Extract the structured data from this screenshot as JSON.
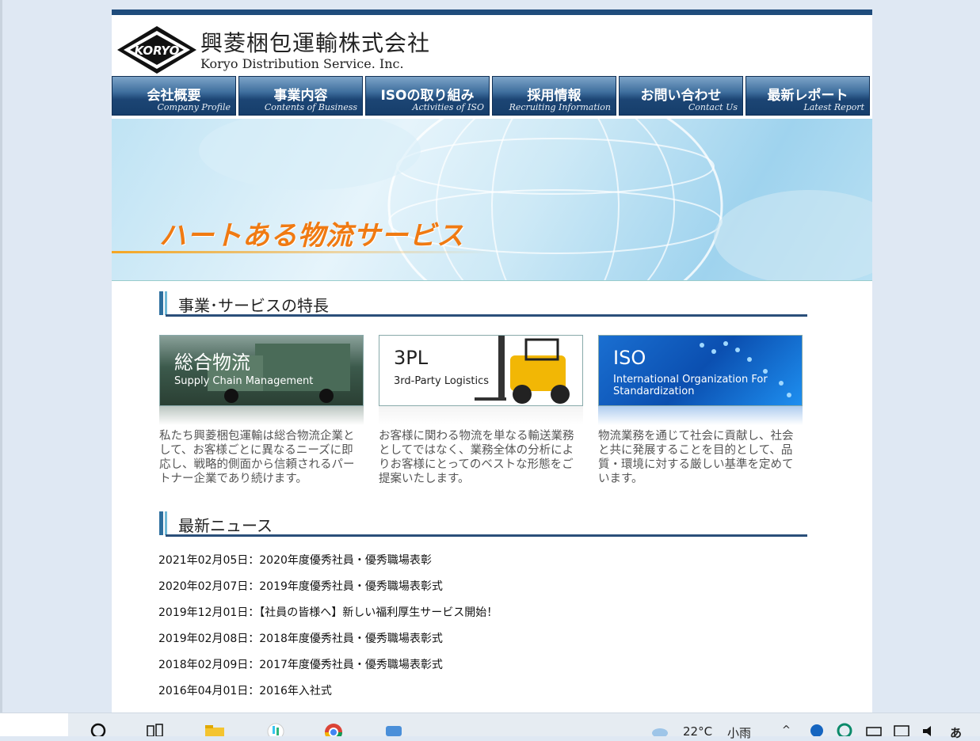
{
  "header": {
    "company_jp": "興菱梱包運輸株式会社",
    "company_en": "Koryo Distribution Service. Inc."
  },
  "nav": [
    {
      "jp": "会社概要",
      "en": "Company Profile"
    },
    {
      "jp": "事業内容",
      "en": "Contents of Business"
    },
    {
      "jp": "ISOの取り組み",
      "en": "Activities of ISO"
    },
    {
      "jp": "採用情報",
      "en": "Recruiting Information"
    },
    {
      "jp": "お問い合わせ",
      "en": "Contact Us"
    },
    {
      "jp": "最新レポート",
      "en": "Latest Report"
    }
  ],
  "hero": {
    "title": "ハートある物流サービス"
  },
  "features": {
    "heading": "事業･サービスの特長",
    "items": [
      {
        "img_title": "総合物流",
        "img_sub": "Supply Chain Management",
        "desc": "私たち興菱梱包運輸は総合物流企業として、お客様ごとに異なるニーズに即応し、戦略的側面から信頼されるパートナー企業であり続けます。"
      },
      {
        "img_title": "3PL",
        "img_sub": "3rd-Party Logistics",
        "desc": "お客様に関わる物流を単なる輸送業務としてではなく、業務全体の分析によりお客様にとってのベストな形態をご提案いたします。"
      },
      {
        "img_title": "ISO",
        "img_sub": "International Organization For Standardization",
        "desc": "物流業務を通じて社会に貢献し、社会と共に発展することを目的として、品質・環境に対する厳しい基準を定めています。"
      }
    ]
  },
  "news": {
    "heading": "最新ニュース",
    "items": [
      "2021年02月05日：2020年度優秀社員・優秀職場表彰",
      "2020年02月07日：2019年度優秀社員・優秀職場表彰式",
      "2019年12月01日：【社員の皆様へ】新しい福利厚生サービス開始！",
      "2019年02月08日：2018年度優秀社員・優秀職場表彰式",
      "2018年02月09日：2017年度優秀社員・優秀職場表彰式",
      "2016年04月01日：2016年入社式"
    ]
  },
  "taskbar": {
    "weather": "22°C",
    "weather_desc": "小雨",
    "ime": "あ",
    "icons": [
      "search-icon",
      "task-view-icon",
      "file-explorer-icon",
      "slack-icon",
      "chrome-icon",
      "app-icon"
    ]
  },
  "colors": {
    "nav_dark": "#1c4574",
    "accent_orange": "#f07a12",
    "rule": "#2a4f7a"
  }
}
